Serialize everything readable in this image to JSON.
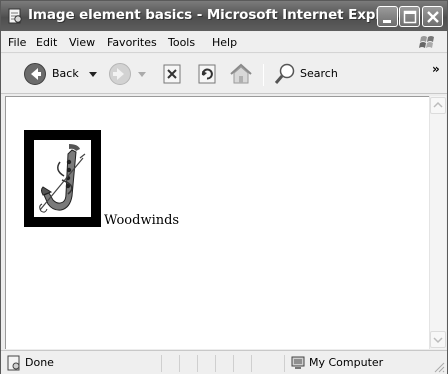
{
  "window": {
    "title": "Image element basics - Microsoft Internet Explo...",
    "controls": {
      "minimize": "minimize",
      "maximize": "maximize",
      "close": "close"
    }
  },
  "menu": [
    "File",
    "Edit",
    "View",
    "Favorites",
    "Tools",
    "Help"
  ],
  "toolbar": {
    "back_label": "Back",
    "search_label": "Search",
    "overflow": "»"
  },
  "content": {
    "image_caption": "Woodwinds"
  },
  "status": {
    "left_text": "Done",
    "zone_text": "My Computer"
  },
  "icons": {
    "page": "ie-page-icon",
    "back": "back-arrow-icon",
    "forward": "forward-arrow-icon",
    "stop": "stop-icon",
    "refresh": "refresh-icon",
    "home": "home-icon",
    "search": "search-magnifier-icon",
    "windows_logo": "windows-logo-icon",
    "computer": "computer-icon"
  }
}
